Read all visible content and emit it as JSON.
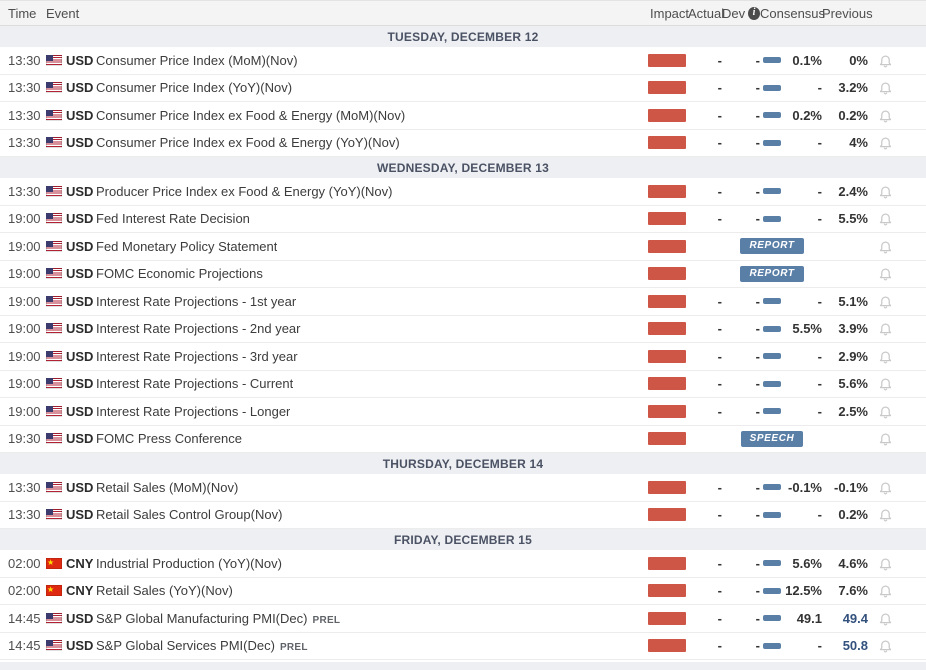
{
  "header": {
    "time": "Time",
    "event": "Event",
    "impact": "Impact",
    "actual": "Actual",
    "dev": "Dev",
    "dev_info_icon": "i",
    "consensus": "Consensus",
    "previous": "Previous"
  },
  "colors": {
    "impact_bar": "#cd5646",
    "badge_bg": "#5a7fa7",
    "revised_value": "#33517d",
    "section_bg": "#edeff2"
  },
  "sections": [
    {
      "title": "TUESDAY, DECEMBER 12",
      "rows": [
        {
          "time": "13:30",
          "flag": "us",
          "currency": "USD",
          "event": "Consumer Price Index (MoM)(Nov)",
          "actual": "-",
          "dev": "-",
          "consensus": "0.1%",
          "previous": "0%"
        },
        {
          "time": "13:30",
          "flag": "us",
          "currency": "USD",
          "event": "Consumer Price Index (YoY)(Nov)",
          "actual": "-",
          "dev": "-",
          "consensus": "-",
          "previous": "3.2%"
        },
        {
          "time": "13:30",
          "flag": "us",
          "currency": "USD",
          "event": "Consumer Price Index ex Food & Energy (MoM)(Nov)",
          "actual": "-",
          "dev": "-",
          "consensus": "0.2%",
          "previous": "0.2%"
        },
        {
          "time": "13:30",
          "flag": "us",
          "currency": "USD",
          "event": "Consumer Price Index ex Food & Energy (YoY)(Nov)",
          "actual": "-",
          "dev": "-",
          "consensus": "-",
          "previous": "4%"
        }
      ]
    },
    {
      "title": "WEDNESDAY, DECEMBER 13",
      "rows": [
        {
          "time": "13:30",
          "flag": "us",
          "currency": "USD",
          "event": "Producer Price Index ex Food & Energy (YoY)(Nov)",
          "actual": "-",
          "dev": "-",
          "consensus": "-",
          "previous": "2.4%"
        },
        {
          "time": "19:00",
          "flag": "us",
          "currency": "USD",
          "event": "Fed Interest Rate Decision",
          "actual": "-",
          "dev": "-",
          "consensus": "-",
          "previous": "5.5%"
        },
        {
          "time": "19:00",
          "flag": "us",
          "currency": "USD",
          "event": "Fed Monetary Policy Statement",
          "badge": "REPORT"
        },
        {
          "time": "19:00",
          "flag": "us",
          "currency": "USD",
          "event": "FOMC Economic Projections",
          "badge": "REPORT"
        },
        {
          "time": "19:00",
          "flag": "us",
          "currency": "USD",
          "event": "Interest Rate Projections - 1st year",
          "actual": "-",
          "dev": "-",
          "consensus": "-",
          "previous": "5.1%"
        },
        {
          "time": "19:00",
          "flag": "us",
          "currency": "USD",
          "event": "Interest Rate Projections - 2nd year",
          "actual": "-",
          "dev": "-",
          "consensus": "5.5%",
          "previous": "3.9%"
        },
        {
          "time": "19:00",
          "flag": "us",
          "currency": "USD",
          "event": "Interest Rate Projections - 3rd year",
          "actual": "-",
          "dev": "-",
          "consensus": "-",
          "previous": "2.9%"
        },
        {
          "time": "19:00",
          "flag": "us",
          "currency": "USD",
          "event": "Interest Rate Projections - Current",
          "actual": "-",
          "dev": "-",
          "consensus": "-",
          "previous": "5.6%"
        },
        {
          "time": "19:00",
          "flag": "us",
          "currency": "USD",
          "event": "Interest Rate Projections - Longer",
          "actual": "-",
          "dev": "-",
          "consensus": "-",
          "previous": "2.5%"
        },
        {
          "time": "19:30",
          "flag": "us",
          "currency": "USD",
          "event": "FOMC Press Conference",
          "badge": "SPEECH"
        }
      ]
    },
    {
      "title": "THURSDAY, DECEMBER 14",
      "rows": [
        {
          "time": "13:30",
          "flag": "us",
          "currency": "USD",
          "event": "Retail Sales (MoM)(Nov)",
          "actual": "-",
          "dev": "-",
          "consensus": "-0.1%",
          "previous": "-0.1%"
        },
        {
          "time": "13:30",
          "flag": "us",
          "currency": "USD",
          "event": "Retail Sales Control Group(Nov)",
          "actual": "-",
          "dev": "-",
          "consensus": "-",
          "previous": "0.2%"
        }
      ]
    },
    {
      "title": "FRIDAY, DECEMBER 15",
      "rows": [
        {
          "time": "02:00",
          "flag": "cn",
          "currency": "CNY",
          "event": "Industrial Production (YoY)(Nov)",
          "actual": "-",
          "dev": "-",
          "consensus": "5.6%",
          "previous": "4.6%"
        },
        {
          "time": "02:00",
          "flag": "cn",
          "currency": "CNY",
          "event": "Retail Sales (YoY)(Nov)",
          "actual": "-",
          "dev": "-",
          "consensus": "12.5%",
          "previous": "7.6%"
        },
        {
          "time": "14:45",
          "flag": "us",
          "currency": "USD",
          "event": "S&P Global Manufacturing PMI(Dec)",
          "suffix": "PREL",
          "actual": "-",
          "dev": "-",
          "consensus": "49.1",
          "previous": "49.4",
          "previous_revised": true
        },
        {
          "time": "14:45",
          "flag": "us",
          "currency": "USD",
          "event": "S&P Global Services PMI(Dec)",
          "suffix": "PREL",
          "actual": "-",
          "dev": "-",
          "consensus": "-",
          "previous": "50.8",
          "previous_revised": true
        }
      ]
    }
  ]
}
